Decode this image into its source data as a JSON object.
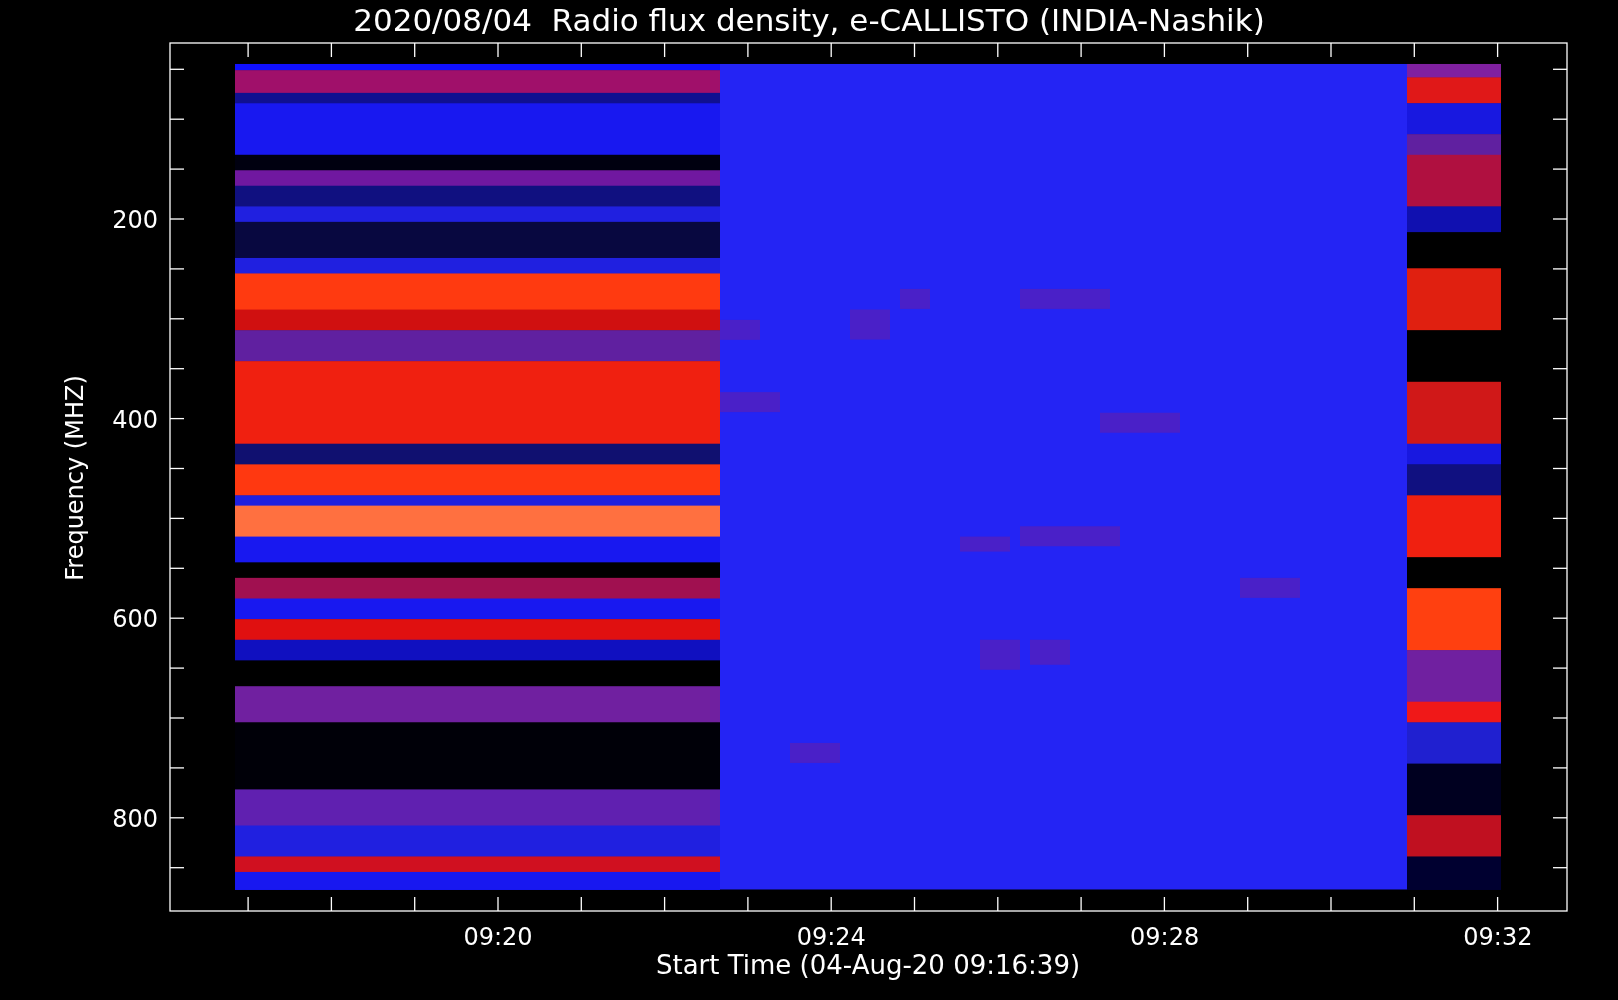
{
  "chart": {
    "title": "2020/08/04  Radio flux density, e-CALLISTO (INDIA-Nashik)",
    "xlabel": "Start Time (04-Aug-20 09:16:39)",
    "ylabel": "Frequency (MHZ)",
    "xticks": [
      "09:20",
      "09:24",
      "09:28",
      "09:32"
    ],
    "yticks": [
      "200",
      "400",
      "600",
      "800"
    ]
  }
}
